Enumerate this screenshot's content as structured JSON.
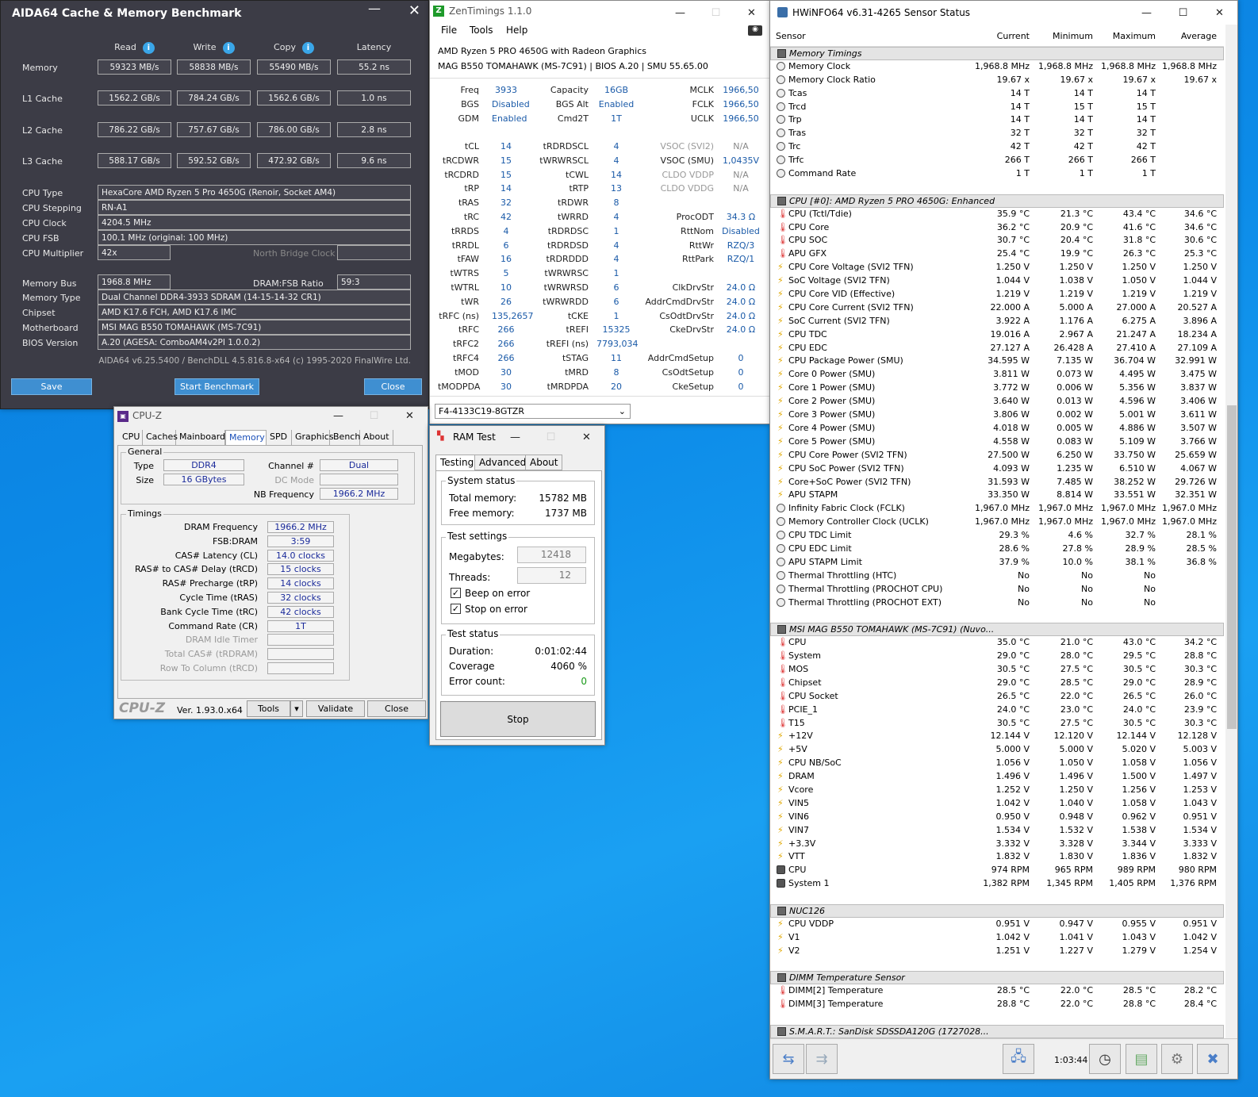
{
  "aida": {
    "title": "AIDA64 Cache & Memory Benchmark",
    "headers": [
      "Read",
      "Write",
      "Copy",
      "Latency"
    ],
    "bench": [
      {
        "label": "Memory",
        "vals": [
          "59323 MB/s",
          "58838 MB/s",
          "55490 MB/s",
          "55.2 ns"
        ]
      },
      {
        "label": "L1 Cache",
        "vals": [
          "1562.2 GB/s",
          "784.24 GB/s",
          "1562.6 GB/s",
          "1.0 ns"
        ]
      },
      {
        "label": "L2 Cache",
        "vals": [
          "786.22 GB/s",
          "757.67 GB/s",
          "786.00 GB/s",
          "2.8 ns"
        ]
      },
      {
        "label": "L3 Cache",
        "vals": [
          "588.17 GB/s",
          "592.52 GB/s",
          "472.92 GB/s",
          "9.6 ns"
        ]
      }
    ],
    "cpu_type_label": "CPU Type",
    "cpu_type": "HexaCore AMD Ryzen 5 Pro 4650G  (Renoir, Socket AM4)",
    "cpu_stepping_label": "CPU Stepping",
    "cpu_stepping": "RN-A1",
    "cpu_clock_label": "CPU Clock",
    "cpu_clock": "4204.5 MHz",
    "cpu_fsb_label": "CPU FSB",
    "cpu_fsb": "100.1 MHz  (original: 100 MHz)",
    "cpu_mult_label": "CPU Multiplier",
    "cpu_mult": "42x",
    "nb_clock_label": "North Bridge Clock",
    "mem_bus_label": "Memory Bus",
    "mem_bus": "1968.8 MHz",
    "dram_fsb_label": "DRAM:FSB Ratio",
    "dram_fsb": "59:3",
    "mem_type_label": "Memory Type",
    "mem_type": "Dual Channel DDR4-3933 SDRAM  (14-15-14-32 CR1)",
    "chipset_label": "Chipset",
    "chipset": "AMD K17.6 FCH, AMD K17.6 IMC",
    "mobo_label": "Motherboard",
    "mobo": "MSI MAG B550 TOMAHAWK (MS-7C91)",
    "bios_label": "BIOS Version",
    "bios": "A.20  (AGESA: ComboAM4v2PI 1.0.0.2)",
    "footer": "AIDA64 v6.25.5400 / BenchDLL 4.5.816.8-x64  (c) 1995-2020 FinalWire Ltd.",
    "save": "Save",
    "start": "Start Benchmark",
    "close": "Close"
  },
  "zen": {
    "title": "ZenTimings 1.1.0",
    "menu": [
      "File",
      "Tools",
      "Help"
    ],
    "cpu": "AMD Ryzen 5 PRO 4650G with Radeon Graphics",
    "board": "MAG B550 TOMAHAWK (MS-7C91) | BIOS A.20 | SMU 55.65.00",
    "top": [
      [
        "Freq",
        "3933",
        "Capacity",
        "16GB",
        "MCLK",
        "1966,50"
      ],
      [
        "BGS",
        "Disabled",
        "BGS Alt",
        "Enabled",
        "FCLK",
        "1966,50"
      ],
      [
        "GDM",
        "Enabled",
        "Cmd2T",
        "1T",
        "UCLK",
        "1966,50"
      ]
    ],
    "rows": [
      [
        "tCL",
        "14",
        "tRDRDSCL",
        "4",
        "VSOC (SVI2)",
        "N/A"
      ],
      [
        "tRCDWR",
        "15",
        "tWRWRSCL",
        "4",
        "VSOC (SMU)",
        "1,0435V"
      ],
      [
        "tRCDRD",
        "15",
        "tCWL",
        "14",
        "CLDO VDDP",
        "N/A"
      ],
      [
        "tRP",
        "14",
        "tRTP",
        "13",
        "CLDO VDDG",
        "N/A"
      ],
      [
        "tRAS",
        "32",
        "tRDWR",
        "8",
        "",
        ""
      ],
      [
        "tRC",
        "42",
        "tWRRD",
        "4",
        "ProcODT",
        "34.3 Ω"
      ],
      [
        "tRRDS",
        "4",
        "tRDRDSC",
        "1",
        "RttNom",
        "Disabled"
      ],
      [
        "tRRDL",
        "6",
        "tRDRDSD",
        "4",
        "RttWr",
        "RZQ/3"
      ],
      [
        "tFAW",
        "16",
        "tRDRDDD",
        "4",
        "RttPark",
        "RZQ/1"
      ],
      [
        "tWTRS",
        "5",
        "tWRWRSC",
        "1",
        "",
        ""
      ],
      [
        "tWTRL",
        "10",
        "tWRWRSD",
        "6",
        "ClkDrvStr",
        "24.0 Ω"
      ],
      [
        "tWR",
        "26",
        "tWRWRDD",
        "6",
        "AddrCmdDrvStr",
        "24.0 Ω"
      ],
      [
        "tRFC (ns)",
        "135,2657",
        "tCKE",
        "1",
        "CsOdtDrvStr",
        "24.0 Ω"
      ],
      [
        "tRFC",
        "266",
        "tREFI",
        "15325",
        "CkeDrvStr",
        "24.0 Ω"
      ],
      [
        "tRFC2",
        "266",
        "tREFI (ns)",
        "7793,034",
        "",
        ""
      ],
      [
        "tRFC4",
        "266",
        "tSTAG",
        "11",
        "AddrCmdSetup",
        "0"
      ],
      [
        "tMOD",
        "30",
        "tMRD",
        "8",
        "CsOdtSetup",
        "0"
      ],
      [
        "tMODPDA",
        "30",
        "tMRDPDA",
        "20",
        "CkeSetup",
        "0"
      ]
    ],
    "profile": "F4-4133C19-8GTZR"
  },
  "cpuz": {
    "title": "CPU-Z",
    "tabs": [
      "CPU",
      "Caches",
      "Mainboard",
      "Memory",
      "SPD",
      "Graphics",
      "Bench",
      "About"
    ],
    "general": "General",
    "type_label": "Type",
    "type": "DDR4",
    "size_label": "Size",
    "size": "16 GBytes",
    "channel_label": "Channel #",
    "channel": "Dual",
    "dc_label": "DC Mode",
    "nbf_label": "NB Frequency",
    "nbf": "1966.2 MHz",
    "timings": "Timings",
    "trows": [
      [
        "DRAM Frequency",
        "1966.2 MHz"
      ],
      [
        "FSB:DRAM",
        "3:59"
      ],
      [
        "CAS# Latency (CL)",
        "14.0 clocks"
      ],
      [
        "RAS# to CAS# Delay (tRCD)",
        "15 clocks"
      ],
      [
        "RAS# Precharge (tRP)",
        "14 clocks"
      ],
      [
        "Cycle Time (tRAS)",
        "32 clocks"
      ],
      [
        "Bank Cycle Time (tRC)",
        "42 clocks"
      ],
      [
        "Command Rate (CR)",
        "1T"
      ],
      [
        "DRAM Idle Timer",
        ""
      ],
      [
        "Total CAS# (tRDRAM)",
        ""
      ],
      [
        "Row To Column (tRCD)",
        ""
      ]
    ],
    "logo": "CPU-Z",
    "version": "Ver. 1.93.0.x64",
    "tools": "Tools",
    "validate": "Validate",
    "close": "Close"
  },
  "ram": {
    "title": "RAM Test",
    "tabs": [
      "Testing",
      "Advanced",
      "About"
    ],
    "sys_status": "System status",
    "total_label": "Total memory:",
    "total": "15782 MB",
    "free_label": "Free memory:",
    "free": "1737 MB",
    "settings": "Test settings",
    "mb_label": "Megabytes:",
    "mb": "12418",
    "thr_label": "Threads:",
    "thr": "12",
    "beep": "Beep on error",
    "stop_err": "Stop on error",
    "test_status": "Test status",
    "dur_label": "Duration:",
    "dur": "0:01:02:44",
    "cov_label": "Coverage",
    "cov": "4060 %",
    "err_label": "Error count:",
    "err": "0",
    "stop": "Stop"
  },
  "hw": {
    "title": "HWiNFO64 v6.31-4265 Sensor Status",
    "cols": [
      "Sensor",
      "Current",
      "Minimum",
      "Maximum",
      "Average"
    ],
    "rows": [
      {
        "g": "Memory Timings"
      },
      {
        "i": "c",
        "n": "Memory Clock",
        "v": [
          "1,968.8 MHz",
          "1,968.8 MHz",
          "1,968.8 MHz",
          "1,968.8 MHz"
        ]
      },
      {
        "i": "c",
        "n": "Memory Clock Ratio",
        "v": [
          "19.67 x",
          "19.67 x",
          "19.67 x",
          "19.67 x"
        ]
      },
      {
        "i": "c",
        "n": "Tcas",
        "v": [
          "14 T",
          "14 T",
          "14 T",
          ""
        ]
      },
      {
        "i": "c",
        "n": "Trcd",
        "v": [
          "14 T",
          "15 T",
          "15 T",
          ""
        ]
      },
      {
        "i": "c",
        "n": "Trp",
        "v": [
          "14 T",
          "14 T",
          "14 T",
          ""
        ]
      },
      {
        "i": "c",
        "n": "Tras",
        "v": [
          "32 T",
          "32 T",
          "32 T",
          ""
        ]
      },
      {
        "i": "c",
        "n": "Trc",
        "v": [
          "42 T",
          "42 T",
          "42 T",
          ""
        ]
      },
      {
        "i": "c",
        "n": "Trfc",
        "v": [
          "266 T",
          "266 T",
          "266 T",
          ""
        ]
      },
      {
        "i": "c",
        "n": "Command Rate",
        "v": [
          "1 T",
          "1 T",
          "1 T",
          ""
        ]
      },
      {
        "e": 1
      },
      {
        "g": "CPU [#0]: AMD Ryzen 5 PRO 4650G: Enhanced"
      },
      {
        "i": "t",
        "n": "CPU (Tctl/Tdie)",
        "v": [
          "35.9 °C",
          "21.3 °C",
          "43.4 °C",
          "34.6 °C"
        ]
      },
      {
        "i": "t",
        "n": "CPU Core",
        "v": [
          "36.2 °C",
          "20.9 °C",
          "41.6 °C",
          "34.6 °C"
        ]
      },
      {
        "i": "t",
        "n": "CPU SOC",
        "v": [
          "30.7 °C",
          "20.4 °C",
          "31.8 °C",
          "30.6 °C"
        ]
      },
      {
        "i": "t",
        "n": "APU GFX",
        "v": [
          "25.4 °C",
          "19.9 °C",
          "26.3 °C",
          "25.3 °C"
        ]
      },
      {
        "i": "b",
        "n": "CPU Core Voltage (SVI2 TFN)",
        "v": [
          "1.250 V",
          "1.250 V",
          "1.250 V",
          "1.250 V"
        ]
      },
      {
        "i": "b",
        "n": "SoC Voltage (SVI2 TFN)",
        "v": [
          "1.044 V",
          "1.038 V",
          "1.050 V",
          "1.044 V"
        ]
      },
      {
        "i": "b",
        "n": "CPU Core VID (Effective)",
        "v": [
          "1.219 V",
          "1.219 V",
          "1.219 V",
          "1.219 V"
        ]
      },
      {
        "i": "b",
        "n": "CPU Core Current (SVI2 TFN)",
        "v": [
          "22.000 A",
          "5.000 A",
          "27.000 A",
          "20.527 A"
        ]
      },
      {
        "i": "b",
        "n": "SoC Current (SVI2 TFN)",
        "v": [
          "3.922 A",
          "1.176 A",
          "6.275 A",
          "3.896 A"
        ]
      },
      {
        "i": "b",
        "n": "CPU TDC",
        "v": [
          "19.016 A",
          "2.967 A",
          "21.247 A",
          "18.234 A"
        ]
      },
      {
        "i": "b",
        "n": "CPU EDC",
        "v": [
          "27.127 A",
          "26.428 A",
          "27.410 A",
          "27.109 A"
        ]
      },
      {
        "i": "b",
        "n": "CPU Package Power (SMU)",
        "v": [
          "34.595 W",
          "7.135 W",
          "36.704 W",
          "32.991 W"
        ]
      },
      {
        "i": "b",
        "n": "Core 0 Power (SMU)",
        "v": [
          "3.811 W",
          "0.073 W",
          "4.495 W",
          "3.475 W"
        ]
      },
      {
        "i": "b",
        "n": "Core 1 Power (SMU)",
        "v": [
          "3.772 W",
          "0.006 W",
          "5.356 W",
          "3.837 W"
        ]
      },
      {
        "i": "b",
        "n": "Core 2 Power (SMU)",
        "v": [
          "3.640 W",
          "0.013 W",
          "4.596 W",
          "3.406 W"
        ]
      },
      {
        "i": "b",
        "n": "Core 3 Power (SMU)",
        "v": [
          "3.806 W",
          "0.002 W",
          "5.001 W",
          "3.611 W"
        ]
      },
      {
        "i": "b",
        "n": "Core 4 Power (SMU)",
        "v": [
          "4.018 W",
          "0.005 W",
          "4.886 W",
          "3.507 W"
        ]
      },
      {
        "i": "b",
        "n": "Core 5 Power (SMU)",
        "v": [
          "4.558 W",
          "0.083 W",
          "5.109 W",
          "3.766 W"
        ]
      },
      {
        "i": "b",
        "n": "CPU Core Power (SVI2 TFN)",
        "v": [
          "27.500 W",
          "6.250 W",
          "33.750 W",
          "25.659 W"
        ]
      },
      {
        "i": "b",
        "n": "CPU SoC Power (SVI2 TFN)",
        "v": [
          "4.093 W",
          "1.235 W",
          "6.510 W",
          "4.067 W"
        ]
      },
      {
        "i": "b",
        "n": "Core+SoC Power (SVI2 TFN)",
        "v": [
          "31.593 W",
          "7.485 W",
          "38.252 W",
          "29.726 W"
        ]
      },
      {
        "i": "b",
        "n": "APU STAPM",
        "v": [
          "33.350 W",
          "8.814 W",
          "33.551 W",
          "32.351 W"
        ]
      },
      {
        "i": "c",
        "n": "Infinity Fabric Clock (FCLK)",
        "v": [
          "1,967.0 MHz",
          "1,967.0 MHz",
          "1,967.0 MHz",
          "1,967.0 MHz"
        ]
      },
      {
        "i": "c",
        "n": "Memory Controller Clock (UCLK)",
        "v": [
          "1,967.0 MHz",
          "1,967.0 MHz",
          "1,967.0 MHz",
          "1,967.0 MHz"
        ]
      },
      {
        "i": "c",
        "n": "CPU TDC Limit",
        "v": [
          "29.3 %",
          "4.6 %",
          "32.7 %",
          "28.1 %"
        ]
      },
      {
        "i": "c",
        "n": "CPU EDC Limit",
        "v": [
          "28.6 %",
          "27.8 %",
          "28.9 %",
          "28.5 %"
        ]
      },
      {
        "i": "c",
        "n": "APU STAPM Limit",
        "v": [
          "37.9 %",
          "10.0 %",
          "38.1 %",
          "36.8 %"
        ]
      },
      {
        "i": "c",
        "n": "Thermal Throttling (HTC)",
        "v": [
          "No",
          "No",
          "No",
          ""
        ]
      },
      {
        "i": "c",
        "n": "Thermal Throttling (PROCHOT CPU)",
        "v": [
          "No",
          "No",
          "No",
          ""
        ]
      },
      {
        "i": "c",
        "n": "Thermal Throttling (PROCHOT EXT)",
        "v": [
          "No",
          "No",
          "No",
          ""
        ]
      },
      {
        "e": 1
      },
      {
        "g": "MSI MAG B550 TOMAHAWK (MS-7C91) (Nuvo..."
      },
      {
        "i": "t",
        "n": "CPU",
        "v": [
          "35.0 °C",
          "21.0 °C",
          "43.0 °C",
          "34.2 °C"
        ]
      },
      {
        "i": "t",
        "n": "System",
        "v": [
          "29.0 °C",
          "28.0 °C",
          "29.5 °C",
          "28.8 °C"
        ]
      },
      {
        "i": "t",
        "n": "MOS",
        "v": [
          "30.5 °C",
          "27.5 °C",
          "30.5 °C",
          "30.3 °C"
        ]
      },
      {
        "i": "t",
        "n": "Chipset",
        "v": [
          "29.0 °C",
          "28.5 °C",
          "29.0 °C",
          "28.9 °C"
        ]
      },
      {
        "i": "t",
        "n": "CPU Socket",
        "v": [
          "26.5 °C",
          "22.0 °C",
          "26.5 °C",
          "26.0 °C"
        ]
      },
      {
        "i": "t",
        "n": "PCIE_1",
        "v": [
          "24.0 °C",
          "23.0 °C",
          "24.0 °C",
          "23.9 °C"
        ]
      },
      {
        "i": "t",
        "n": "T15",
        "v": [
          "30.5 °C",
          "27.5 °C",
          "30.5 °C",
          "30.3 °C"
        ]
      },
      {
        "i": "b",
        "n": "+12V",
        "v": [
          "12.144 V",
          "12.120 V",
          "12.144 V",
          "12.128 V"
        ]
      },
      {
        "i": "b",
        "n": "+5V",
        "v": [
          "5.000 V",
          "5.000 V",
          "5.020 V",
          "5.003 V"
        ]
      },
      {
        "i": "b",
        "n": "CPU NB/SoC",
        "v": [
          "1.056 V",
          "1.050 V",
          "1.058 V",
          "1.056 V"
        ]
      },
      {
        "i": "b",
        "n": "DRAM",
        "v": [
          "1.496 V",
          "1.496 V",
          "1.500 V",
          "1.497 V"
        ]
      },
      {
        "i": "b",
        "n": "Vcore",
        "v": [
          "1.252 V",
          "1.250 V",
          "1.256 V",
          "1.253 V"
        ]
      },
      {
        "i": "b",
        "n": "VIN5",
        "v": [
          "1.042 V",
          "1.040 V",
          "1.058 V",
          "1.043 V"
        ]
      },
      {
        "i": "b",
        "n": "VIN6",
        "v": [
          "0.950 V",
          "0.948 V",
          "0.962 V",
          "0.951 V"
        ]
      },
      {
        "i": "b",
        "n": "VIN7",
        "v": [
          "1.534 V",
          "1.532 V",
          "1.538 V",
          "1.534 V"
        ]
      },
      {
        "i": "b",
        "n": "+3.3V",
        "v": [
          "3.332 V",
          "3.328 V",
          "3.344 V",
          "3.333 V"
        ]
      },
      {
        "i": "b",
        "n": "VTT",
        "v": [
          "1.832 V",
          "1.830 V",
          "1.836 V",
          "1.832 V"
        ]
      },
      {
        "i": "f",
        "n": "CPU",
        "v": [
          "974 RPM",
          "965 RPM",
          "989 RPM",
          "980 RPM"
        ]
      },
      {
        "i": "f",
        "n": "System 1",
        "v": [
          "1,382 RPM",
          "1,345 RPM",
          "1,405 RPM",
          "1,376 RPM"
        ]
      },
      {
        "e": 1
      },
      {
        "g": "NUC126"
      },
      {
        "i": "b",
        "n": "CPU VDDP",
        "v": [
          "0.951 V",
          "0.947 V",
          "0.955 V",
          "0.951 V"
        ]
      },
      {
        "i": "b",
        "n": "V1",
        "v": [
          "1.042 V",
          "1.041 V",
          "1.043 V",
          "1.042 V"
        ]
      },
      {
        "i": "b",
        "n": "V2",
        "v": [
          "1.251 V",
          "1.227 V",
          "1.279 V",
          "1.254 V"
        ]
      },
      {
        "e": 1
      },
      {
        "g": "DIMM Temperature Sensor"
      },
      {
        "i": "t",
        "n": "DIMM[2] Temperature",
        "v": [
          "28.5 °C",
          "22.0 °C",
          "28.5 °C",
          "28.2 °C"
        ]
      },
      {
        "i": "t",
        "n": "DIMM[3] Temperature",
        "v": [
          "28.8 °C",
          "22.0 °C",
          "28.8 °C",
          "28.4 °C"
        ]
      },
      {
        "e": 1
      },
      {
        "g": "S.M.A.R.T.: SanDisk SDSSDA120G (1727028..."
      }
    ],
    "time": "1:03:44"
  }
}
